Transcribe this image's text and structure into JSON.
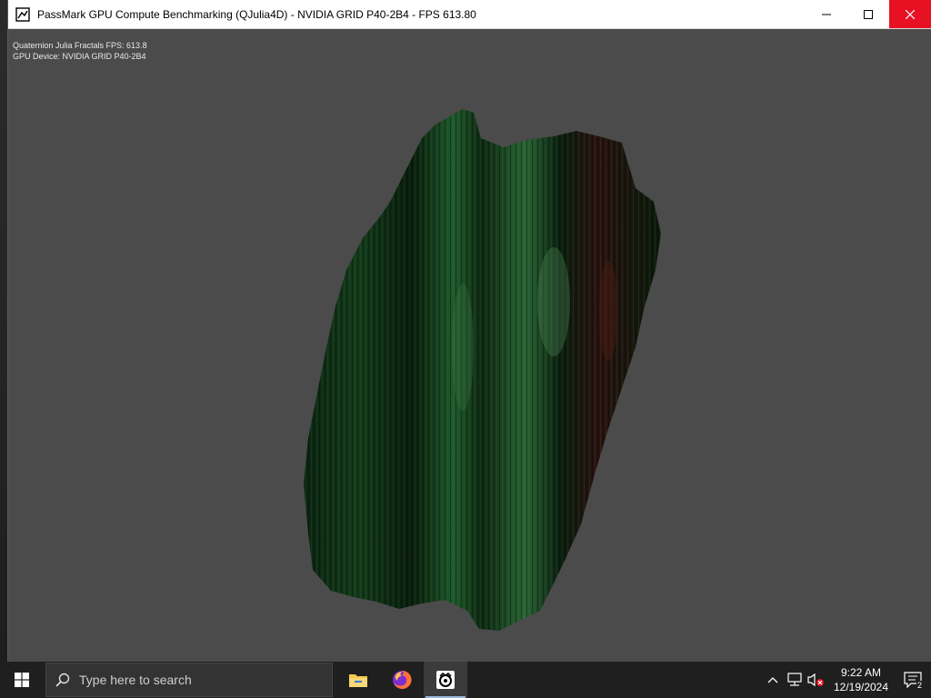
{
  "window": {
    "title": "PassMark GPU Compute Benchmarking (QJulia4D) - NVIDIA GRID P40-2B4 - FPS 613.80",
    "app_icon": "passmark-app-icon",
    "controls": [
      "minimize-icon",
      "maximize-icon",
      "close-icon"
    ]
  },
  "overlay": {
    "line1": "Quaternion Julia Fractals FPS: 613.8",
    "line2": "GPU Device: NVIDIA GRID P40-2B4"
  },
  "render": {
    "background_color": "#4b4b4b",
    "fractal_color": "#0d2f12",
    "highlight_color": "#2f6a3a",
    "accent_color": "#3a1410"
  },
  "taskbar": {
    "start_icon": "windows-logo-icon",
    "search": {
      "placeholder": "Type here to search",
      "icon": "search-icon"
    },
    "pinned": [
      {
        "name": "file-explorer",
        "icon": "folder-icon"
      },
      {
        "name": "firefox",
        "icon": "firefox-icon"
      },
      {
        "name": "passmark",
        "icon": "passmark-icon",
        "active": true
      }
    ],
    "tray": {
      "icons": [
        "chevron-up-icon",
        "network-icon",
        "volume-muted-icon"
      ],
      "time": "9:22 AM",
      "date": "12/19/2024",
      "notification_count": "2"
    }
  }
}
